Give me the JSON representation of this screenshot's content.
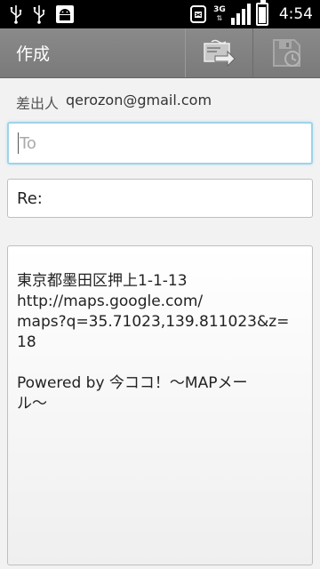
{
  "status_bar": {
    "time": "4:54",
    "network": "3G"
  },
  "action_bar": {
    "title": "作成",
    "send_icon": "send-icon",
    "save_icon": "save-draft-icon"
  },
  "sender": {
    "label": "差出人",
    "address": "qerozon@gmail.com"
  },
  "to_field": {
    "placeholder": "To",
    "value": ""
  },
  "subject_field": {
    "value": "Re:"
  },
  "body": {
    "lines": [
      "東京都墨田区押上1-1-13",
      "http://maps.google.com/",
      "maps?q=35.71023,139.811023&z=",
      "18",
      "",
      "Powered by 今ココ！～MAPメー",
      "ル～"
    ]
  }
}
